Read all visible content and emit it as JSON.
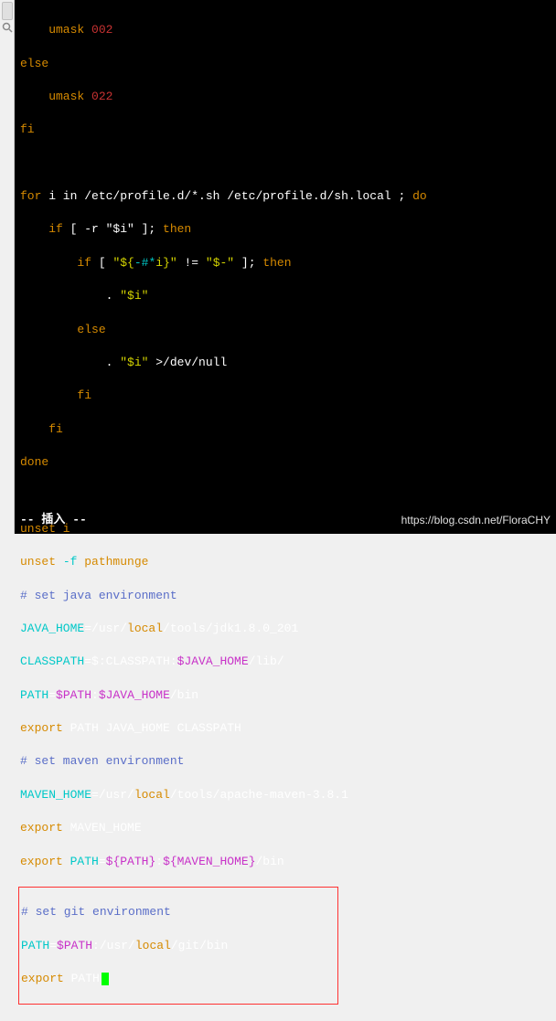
{
  "lines": {
    "l1_umask": "    umask ",
    "l1_002": "002",
    "l2_else": "else",
    "l3_umask": "    umask ",
    "l3_022": "022",
    "l4_fi": "fi",
    "l6_for": "for",
    "l6_i_in": " i in ",
    "l6_paths": "/etc/profile.d/*.sh /etc/profile.d/sh.local ",
    "l6_semi": "; ",
    "l6_do": "do",
    "l7_if": "    if ",
    "l7_test": "[ -r \"$i\" ]; ",
    "l7_then": "then",
    "l8_if": "        if ",
    "l8_b1": "[ ",
    "l8_q1": "\"${",
    "l8_hash": "-#*",
    "l8_i": "i",
    "l8_q2": "}\"",
    "l8_ne": " != ",
    "l8_q3": "\"$-\" ",
    "l8_b2": "]; ",
    "l8_then": "then",
    "l9_dot": "            . ",
    "l9_i": "\"$i\"",
    "l10_else": "        else",
    "l11_dot": "            . ",
    "l11_i": "\"$i\" ",
    "l11_gt": ">",
    "l11_dev": "/dev/null",
    "l12_fi": "        fi",
    "l13_fi": "    fi",
    "l14_done": "done",
    "l16_unset": "unset i",
    "l17_unset": "unset ",
    "l17_f": "-f",
    "l17_path": " pathmunge",
    "l18_c": "# set java environment",
    "l19_a": "JAVA_HOME",
    "l19_b": "=/usr/",
    "l19_c": "local",
    "l19_d": "/tools/jdk1.8.0_201",
    "l20_a": "CLASSPATH",
    "l20_b": "=$:CLASSPATH:",
    "l20_c": "$JAVA_HOME",
    "l20_d": "/lib/",
    "l21_a": "PATH",
    "l21_b": "=",
    "l21_c": "$PATH",
    "l21_d": ":",
    "l21_e": "$JAVA_HOME",
    "l21_f": "/bin",
    "l22_a": "export",
    "l22_b": " PATH JAVA_HOME CLASSPATH",
    "l23_c": "# set maven environment",
    "l24_a": "MAVEN_HOME",
    "l24_b": "=/usr/",
    "l24_c": "local",
    "l24_d": "/tools/apache-maven-3.8.1",
    "l25_a": "export",
    "l25_b": " MAVEN_HOME",
    "l26_a": "export",
    "l26_b": " ",
    "l26_c": "PATH",
    "l26_d": "=",
    "l26_e": "${PATH}",
    "l26_f": ":",
    "l26_g": "${MAVEN_HOME}",
    "l26_h": "/bin",
    "l27_c": "# set git environment",
    "l28_a": "PATH",
    "l28_b": "=",
    "l28_c": "$PATH",
    "l28_d": ":/usr/",
    "l28_e": "local",
    "l28_f": "/git/bin",
    "l29_a": "export",
    "l29_b": " PATH"
  },
  "status": "-- 插入 --",
  "watermark": "https://blog.csdn.net/FloraCHY"
}
